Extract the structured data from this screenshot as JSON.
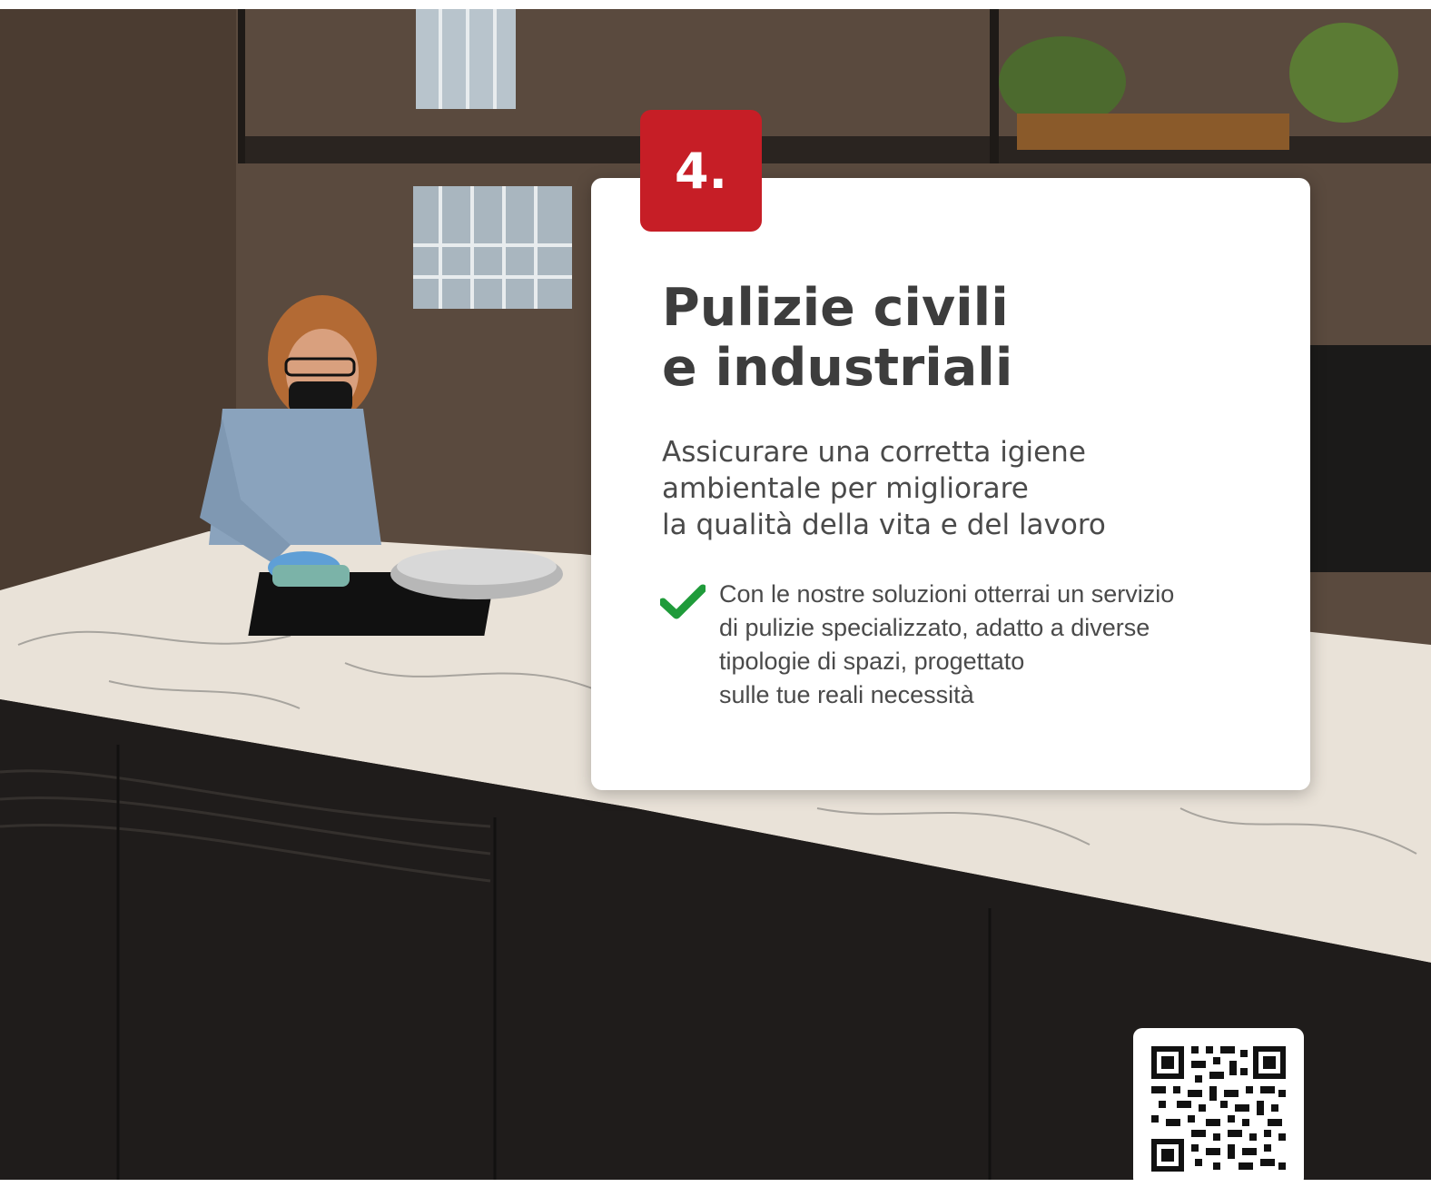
{
  "photo": {
    "subject": "cleaner-wiping-marble-kitchen-island"
  },
  "badge": {
    "number": "4."
  },
  "card": {
    "title": "Pulizie civili\ne industriali",
    "subtitle": "Assicurare una corretta igiene\nambientale per migliorare\nla qualità della vita e del lavoro",
    "bullet": "Con le nostre soluzioni otterrai un servizio\ndi pulizie specializzato, adatto a diverse\ntipologie di spazi, progettato\nsulle tue reali necessità",
    "check_icon": "check-icon"
  },
  "qr": {
    "icon": "qr-code-icon"
  },
  "colors": {
    "accent_red": "#c61e26",
    "check_green": "#1f9b3a",
    "text_dark": "#3d3d3d"
  }
}
